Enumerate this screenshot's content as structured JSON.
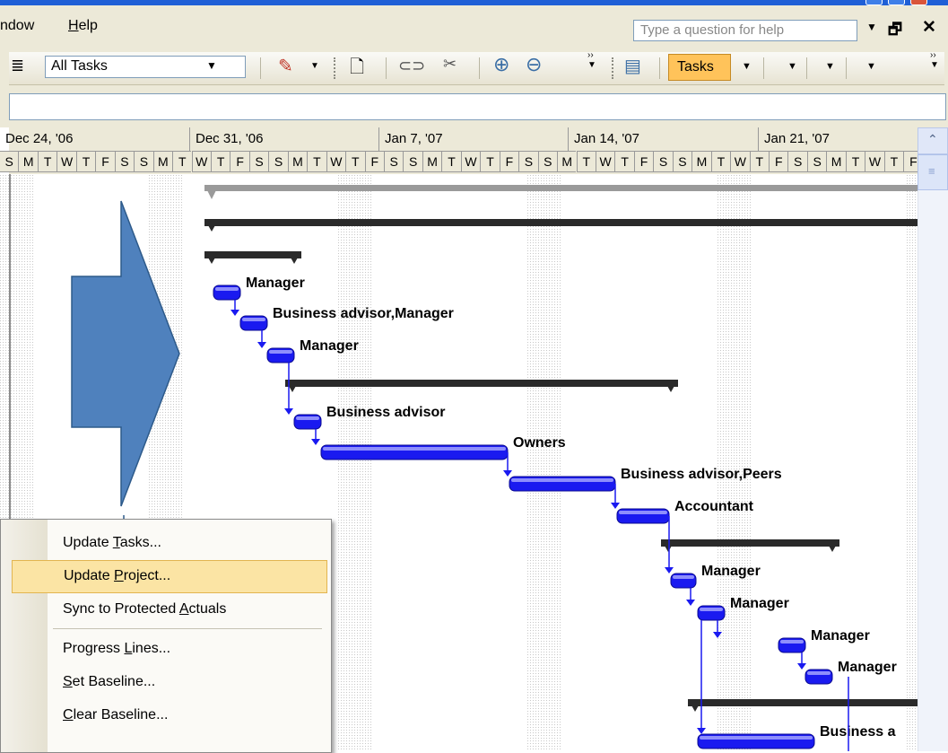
{
  "menu": {
    "window_partial": "ndow",
    "help": "Help",
    "help_placeholder": "Type a question for help"
  },
  "toolbar": {
    "filter_value": "All Tasks",
    "tasks_label": "Tasks"
  },
  "timescale": {
    "weeks": [
      "Dec 24, '06",
      "Dec 31, '06",
      "Jan 7, '07",
      "Jan 14, '07",
      "Jan 21, '07"
    ],
    "days": [
      "S",
      "M",
      "T",
      "W",
      "T",
      "F",
      "S"
    ]
  },
  "gantt": {
    "resource_labels": [
      "Manager",
      "Business advisor,Manager",
      "Manager",
      "Business advisor",
      "Owners",
      "Business advisor,Peers",
      "Accountant",
      "Manager",
      "Manager",
      "Manager",
      "Manager",
      "Business a"
    ]
  },
  "context_menu": {
    "items": [
      {
        "label": "Update Tasks...",
        "key": "T"
      },
      {
        "label": "Update Project...",
        "key": "P",
        "highlighted": true
      },
      {
        "label": "Sync to Protected Actuals",
        "key": "A"
      },
      {
        "label": "Progress Lines...",
        "key": "L"
      },
      {
        "label": "Set Baseline...",
        "key": "S"
      },
      {
        "label": "Clear Baseline...",
        "key": "C"
      }
    ]
  },
  "colors": {
    "arrow_fill": "#4f81bd",
    "task_bar": "#1a1af0",
    "summary_bar": "#2a2a2a",
    "menu_highlight": "#fbe4a4"
  }
}
